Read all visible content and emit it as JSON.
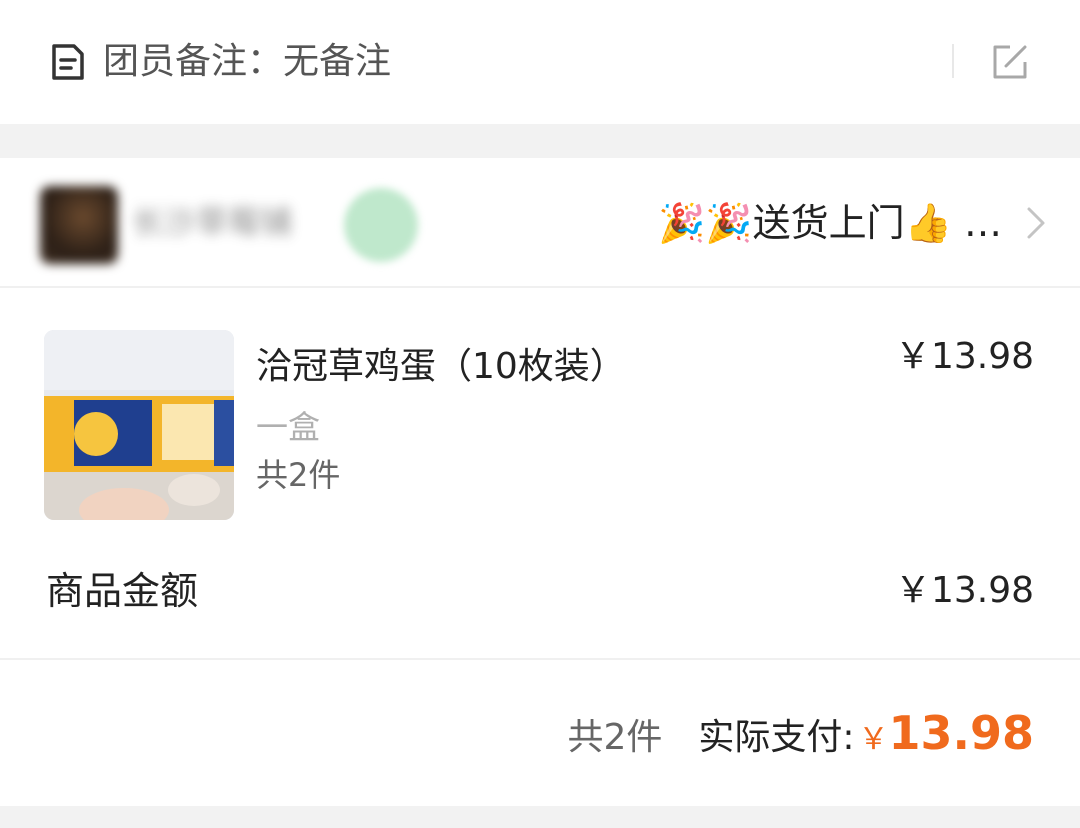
{
  "note": {
    "label": "团员备注：无备注",
    "icon": "document-icon",
    "edit_icon": "edit-icon"
  },
  "store": {
    "name": "长沙草莓铺",
    "delivery_text": "🎉🎉送货上门👍 …"
  },
  "product": {
    "name": "洽冠草鸡蛋（10枚装）",
    "price": "￥13.98",
    "spec": "一盒",
    "quantity": "共2件"
  },
  "subtotal": {
    "label": "商品金额",
    "value": "￥13.98"
  },
  "summary": {
    "count": "共2件",
    "paid_label": "实际支付:",
    "currency": "￥",
    "amount": "13.98",
    "accent_color": "#f06a1d"
  }
}
